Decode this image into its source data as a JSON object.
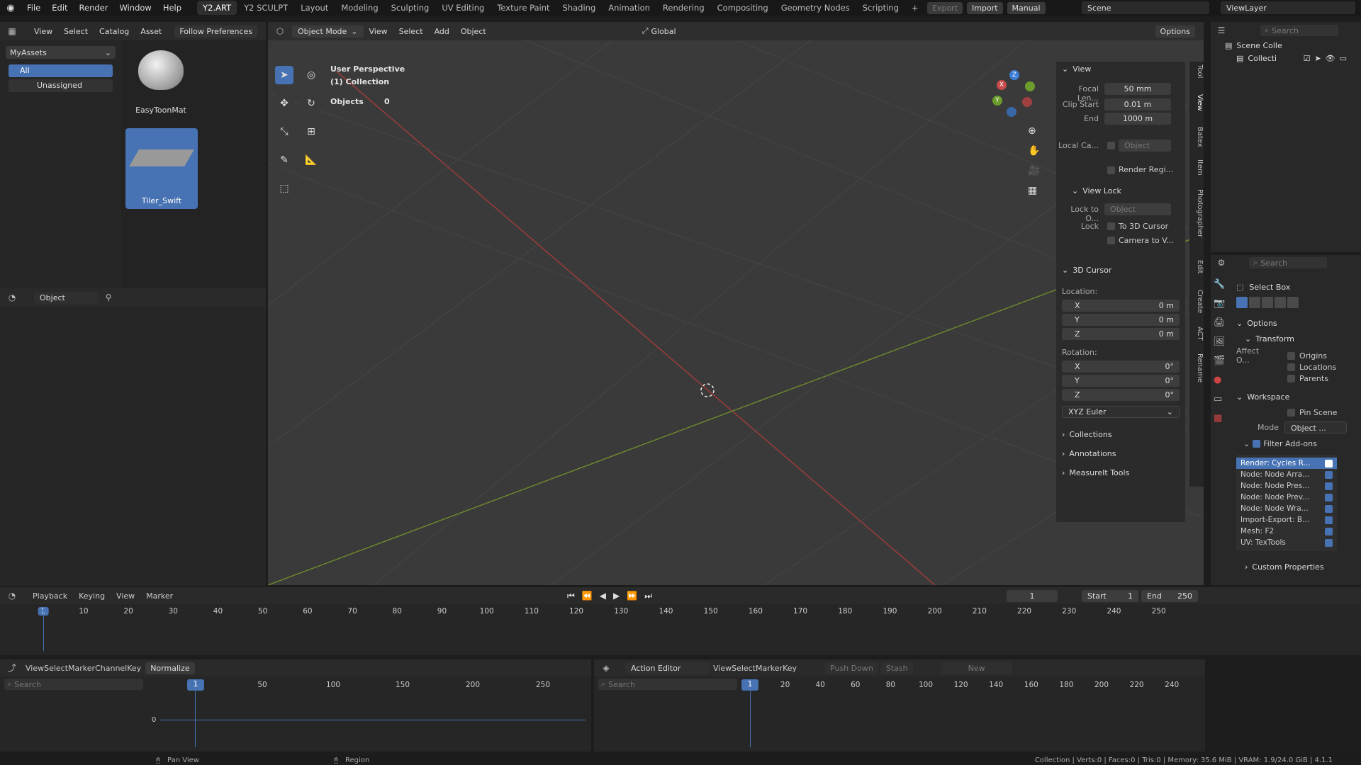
{
  "topbar": {
    "menus": [
      "File",
      "Edit",
      "Render",
      "Window",
      "Help"
    ],
    "workspaces": [
      "Y2.ART",
      "Y2 SCULPT",
      "Layout",
      "Modeling",
      "Sculpting",
      "UV Editing",
      "Texture Paint",
      "Shading",
      "Animation",
      "Rendering",
      "Compositing",
      "Geometry Nodes",
      "Scripting"
    ],
    "export_label": "Export",
    "import_label": "Import",
    "manual_label": "Manual",
    "scene": "Scene",
    "view_layer": "ViewLayer"
  },
  "asset_browser": {
    "menus": [
      "View",
      "Select",
      "Catalog",
      "Asset"
    ],
    "follow_prefs": "Follow Preferences",
    "library": "MyAssets",
    "catalog_all": "All",
    "catalog_unassigned": "Unassigned",
    "assets": [
      "EasyToonMat",
      "Tiler_Swift"
    ]
  },
  "left_lower": {
    "mode": "Object"
  },
  "viewport": {
    "mode": "Object Mode",
    "menus": [
      "View",
      "Select",
      "Add",
      "Object"
    ],
    "orientation": "Global",
    "options": "Options",
    "overlay_title": "User Perspective",
    "overlay_collection": "(1) Collection",
    "objects_label": "Objects",
    "objects_count": "0"
  },
  "npanel": {
    "view_title": "View",
    "focal_label": "Focal Len...",
    "focal": "50 mm",
    "clip_start_label": "Clip Start",
    "clip_start": "0.01 m",
    "end_label": "End",
    "clip_end": "1000 m",
    "local_cam_label": "Local Ca...",
    "object_placeholder": "Object",
    "render_region": "Render Regi...",
    "view_lock": "View Lock",
    "lock_to": "Lock to O...",
    "lock_label": "Lock",
    "to_cursor": "To 3D Cursor",
    "camera_to_view": "Camera to V...",
    "cursor_title": "3D Cursor",
    "location": "Location:",
    "rotation": "Rotation:",
    "loc": [
      {
        "axis": "X",
        "val": "0 m"
      },
      {
        "axis": "Y",
        "val": "0 m"
      },
      {
        "axis": "Z",
        "val": "0 m"
      }
    ],
    "rot": [
      {
        "axis": "X",
        "val": "0°"
      },
      {
        "axis": "Y",
        "val": "0°"
      },
      {
        "axis": "Z",
        "val": "0°"
      }
    ],
    "euler": "XYZ Euler",
    "collections": "Collections",
    "annotations": "Annotations",
    "measureit": "MeasureIt Tools",
    "tabs": [
      "Tool",
      "View",
      "Batex",
      "Item",
      "Photographer",
      "Edit",
      "Create",
      "ACT",
      "Rename"
    ]
  },
  "outliner": {
    "search": "Search",
    "scene_collection": "Scene Colle",
    "collection": "Collecti"
  },
  "properties": {
    "search": "Search",
    "select_box": "Select Box",
    "options": "Options",
    "transform": "Transform",
    "affect": "Affect O...",
    "origins": "Origins",
    "locations": "Locations",
    "parents": "Parents",
    "workspace": "Workspace",
    "pin_scene": "Pin Scene",
    "mode_label": "Mode",
    "mode_val": "Object ...",
    "filter_addons": "Filter Add-ons",
    "addons": [
      "Render: Cycles R...",
      "Node: Node Arra...",
      "Node: Node Pres...",
      "Node: Node Prev...",
      "Node: Node Wra...",
      "Import-Export: B...",
      "Mesh: F2",
      "UV: TexTools"
    ],
    "custom_props": "Custom Properties"
  },
  "timeline": {
    "menus": [
      "Playback",
      "Keying",
      "View",
      "Marker"
    ],
    "current_frame": "1",
    "start_label": "Start",
    "start": "1",
    "end_label": "End",
    "end": "250",
    "ticks": [
      "1",
      "10",
      "20",
      "30",
      "40",
      "50",
      "60",
      "70",
      "80",
      "90",
      "100",
      "110",
      "120",
      "130",
      "140",
      "150",
      "160",
      "170",
      "180",
      "190",
      "200",
      "210",
      "220",
      "230",
      "240",
      "250"
    ]
  },
  "graph": {
    "menus": [
      "View",
      "Select",
      "Marker",
      "Channel",
      "Key"
    ],
    "normalize": "Normalize",
    "search": "Search",
    "frame": "1",
    "ticks": [
      "50",
      "100",
      "150",
      "200",
      "250"
    ],
    "zero": "0"
  },
  "action": {
    "mode": "Action Editor",
    "menus": [
      "View",
      "Select",
      "Marker",
      "Key"
    ],
    "push_down": "Push Down",
    "stash": "Stash",
    "new": "New",
    "search": "Search",
    "frame": "1",
    "ticks": [
      "20",
      "40",
      "60",
      "80",
      "100",
      "120",
      "140",
      "160",
      "180",
      "200",
      "220",
      "240"
    ]
  },
  "status": {
    "pan": "Pan View",
    "region": "Region",
    "info": "Collection | Verts:0 | Faces:0 | Tris:0 | Memory: 35.6 MiB | VRAM: 1.9/24.0 GiB | 4.1.1"
  }
}
